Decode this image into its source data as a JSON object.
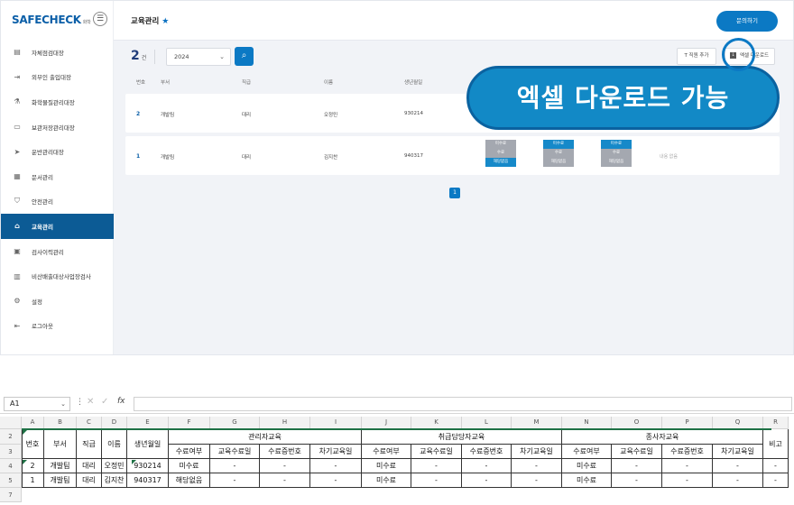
{
  "sidebar": {
    "logo": "SAFECHECK",
    "logo_sub": "화학",
    "items": [
      {
        "label": "자체점검대장",
        "icon": "document-check-icon"
      },
      {
        "label": "외부인 출입대장",
        "icon": "door-icon"
      },
      {
        "label": "화학물질관리대장",
        "icon": "flask-icon"
      },
      {
        "label": "보관저장관리대장",
        "icon": "storage-box-icon"
      },
      {
        "label": "운반관리대장",
        "icon": "truck-icon"
      },
      {
        "label": "문서관리",
        "icon": "folder-icon"
      },
      {
        "label": "안전관리",
        "icon": "shield-icon"
      },
      {
        "label": "교육관리",
        "icon": "graduation-cap-icon"
      },
      {
        "label": "검사이력관리",
        "icon": "clipboard-icon"
      },
      {
        "label": "비산배출대상사업장검사",
        "icon": "factory-icon"
      },
      {
        "label": "설정",
        "icon": "gear-icon"
      },
      {
        "label": "로그아웃",
        "icon": "logout-icon"
      }
    ],
    "active_index": 7
  },
  "header": {
    "title": "교육관리",
    "inquiry_label": "문의하기"
  },
  "toolbar": {
    "count": "2",
    "count_unit": "건",
    "year": "2024",
    "add_staff_label": "직원 추가",
    "excel_label": "엑셀 다운로드"
  },
  "table": {
    "headers": [
      "번호",
      "부서",
      "직급",
      "이름",
      "생년월일"
    ],
    "rows": [
      {
        "no": "2",
        "dept": "개발팀",
        "rank": "대리",
        "name": "오정민",
        "birth": "930214"
      },
      {
        "no": "1",
        "dept": "개발팀",
        "rank": "대리",
        "name": "김지찬",
        "birth": "940317",
        "status_groups": [
          [
            "미수료",
            "수료",
            "해당없음"
          ],
          [
            "미수료",
            "수료",
            "해당없음"
          ],
          [
            "미수료",
            "수료",
            "해당없음"
          ]
        ],
        "note": "내용 없음"
      }
    ]
  },
  "pager": {
    "current": "1"
  },
  "callout": {
    "text": "엑셀 다운로드 가능"
  },
  "sheet": {
    "namebox": "A1",
    "columns": [
      "A",
      "B",
      "C",
      "D",
      "E",
      "F",
      "G",
      "H",
      "I",
      "J",
      "K",
      "L",
      "M",
      "N",
      "O",
      "P",
      "Q",
      "R"
    ],
    "row_numbers": [
      "2",
      "3",
      "4",
      "5",
      "7"
    ],
    "headers": {
      "no": "번호",
      "dept": "부서",
      "rank": "직급",
      "name": "이름",
      "birth": "생년월일",
      "note": "비고",
      "groups": [
        "관리자교육",
        "취급담당자교육",
        "종사자교육"
      ],
      "sub": [
        "수료여부",
        "교육수료일",
        "수료증번호",
        "차기교육일"
      ]
    },
    "rows": [
      {
        "no": "2",
        "dept": "개발팀",
        "rank": "대리",
        "name": "오정민",
        "birth": "930214",
        "g1": [
          "미수료",
          "-",
          "-",
          "-"
        ],
        "g2": [
          "미수료",
          "-",
          "-",
          "-"
        ],
        "g3": [
          "미수료",
          "-",
          "-",
          "-"
        ],
        "note": "-"
      },
      {
        "no": "1",
        "dept": "개발팀",
        "rank": "대리",
        "name": "김지찬",
        "birth": "940317",
        "g1": [
          "해당없음",
          "-",
          "-",
          "-"
        ],
        "g2": [
          "미수료",
          "-",
          "-",
          "-"
        ],
        "g3": [
          "미수료",
          "-",
          "-",
          "-"
        ],
        "note": "-"
      }
    ]
  },
  "colors": {
    "brand": "#0b79c4",
    "active_nav": "#0c5b95",
    "excel_green": "#1e7145"
  }
}
